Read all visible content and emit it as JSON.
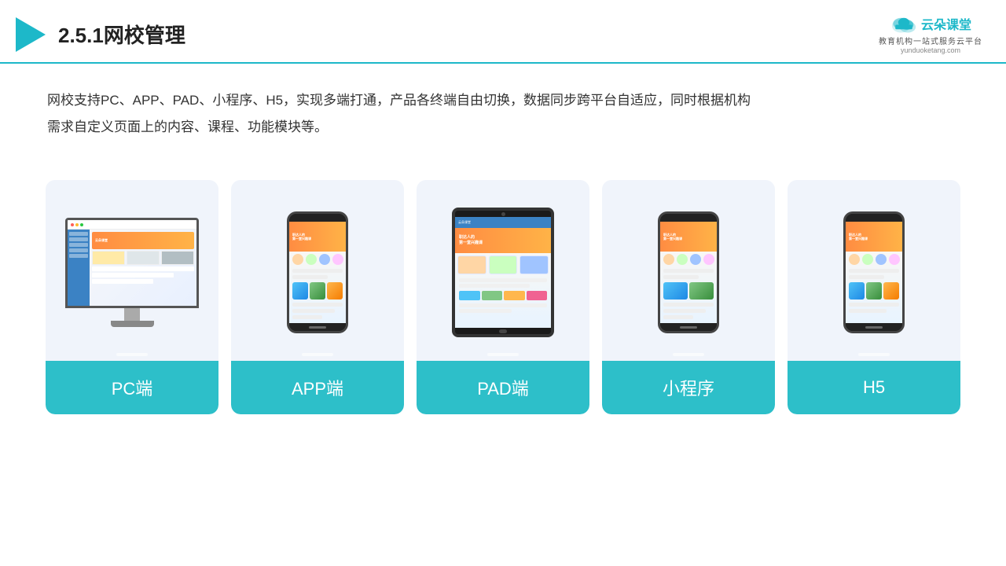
{
  "header": {
    "title": "2.5.1网校管理",
    "logo_name": "云朵课堂",
    "logo_slogan": "教育机构一站式服务云平台",
    "logo_url": "yunduoketang.com"
  },
  "description": {
    "text1": "网校支持PC、APP、PAD、小程序、H5，实现多端打通，产品各终端自由切换，数据同步跨平台自适应，同时根据机构",
    "text2": "需求自定义页面上的内容、课程、功能模块等。"
  },
  "cards": [
    {
      "id": "pc",
      "label": "PC端"
    },
    {
      "id": "app",
      "label": "APP端"
    },
    {
      "id": "pad",
      "label": "PAD端"
    },
    {
      "id": "miniprogram",
      "label": "小程序"
    },
    {
      "id": "h5",
      "label": "H5"
    }
  ]
}
